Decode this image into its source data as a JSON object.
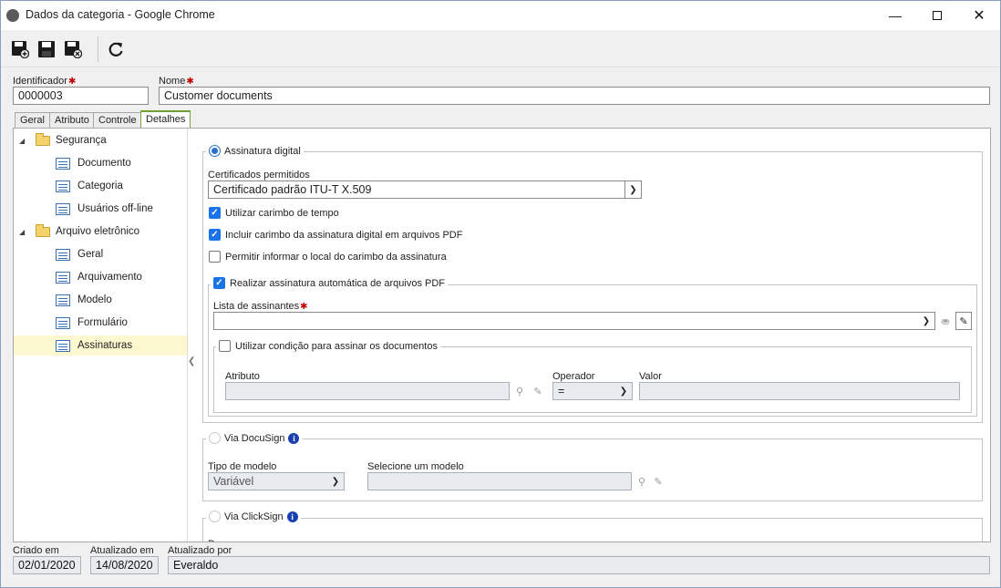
{
  "window": {
    "title": "Dados da categoria - Google Chrome"
  },
  "toolbar": {
    "buttons": [
      "save-new-icon",
      "save-icon",
      "save-close-icon",
      "refresh-icon"
    ]
  },
  "header": {
    "identifier_label": "Identificador",
    "identifier_value": "0000003",
    "name_label": "Nome",
    "name_value": "Customer documents"
  },
  "tabs": [
    {
      "label": "Geral"
    },
    {
      "label": "Atributo"
    },
    {
      "label": "Controle"
    },
    {
      "label": "Detalhes",
      "active": true
    }
  ],
  "tree": {
    "groups": [
      {
        "label": "Segurança",
        "items": [
          "Documento",
          "Categoria",
          "Usuários off-line"
        ]
      },
      {
        "label": "Arquivo eletrônico",
        "items": [
          "Geral",
          "Arquivamento",
          "Modelo",
          "Formulário",
          "Assinaturas"
        ]
      }
    ],
    "selected": "Assinaturas"
  },
  "digital": {
    "legend": "Assinatura digital",
    "cert_label": "Certificados permitidos",
    "cert_value": "Certificado padrão ITU-T X.509",
    "chk_timestamp": "Utilizar carimbo de tempo",
    "chk_include_pdf": "Incluir carimbo da assinatura digital em arquivos PDF",
    "chk_allow_local": "Permitir informar o local do carimbo da assinatura",
    "auto": {
      "legend": "Realizar assinatura automática de arquivos PDF",
      "signers_label": "Lista de assinantes",
      "signers_value": "",
      "cond": {
        "legend": "Utilizar condição para assinar os documentos",
        "attr_label": "Atributo",
        "op_label": "Operador",
        "op_value": "=",
        "value_label": "Valor"
      }
    }
  },
  "docusign": {
    "legend": "Via DocuSign",
    "model_type_label": "Tipo de modelo",
    "model_type_value": "Variável",
    "select_model_label": "Selecione um modelo"
  },
  "clicksign": {
    "legend": "Via ClickSign",
    "cut_label": "D"
  },
  "footer": {
    "created_label": "Criado em",
    "created_value": "02/01/2020",
    "updated_label": "Atualizado em",
    "updated_value": "14/08/2020",
    "updated_by_label": "Atualizado por",
    "updated_by_value": "Everaldo"
  },
  "colors": {
    "accent": "#1a73e8",
    "required": "#c00000",
    "tab_active_border": "#6fa030",
    "selected_row": "#fdf8d0"
  }
}
